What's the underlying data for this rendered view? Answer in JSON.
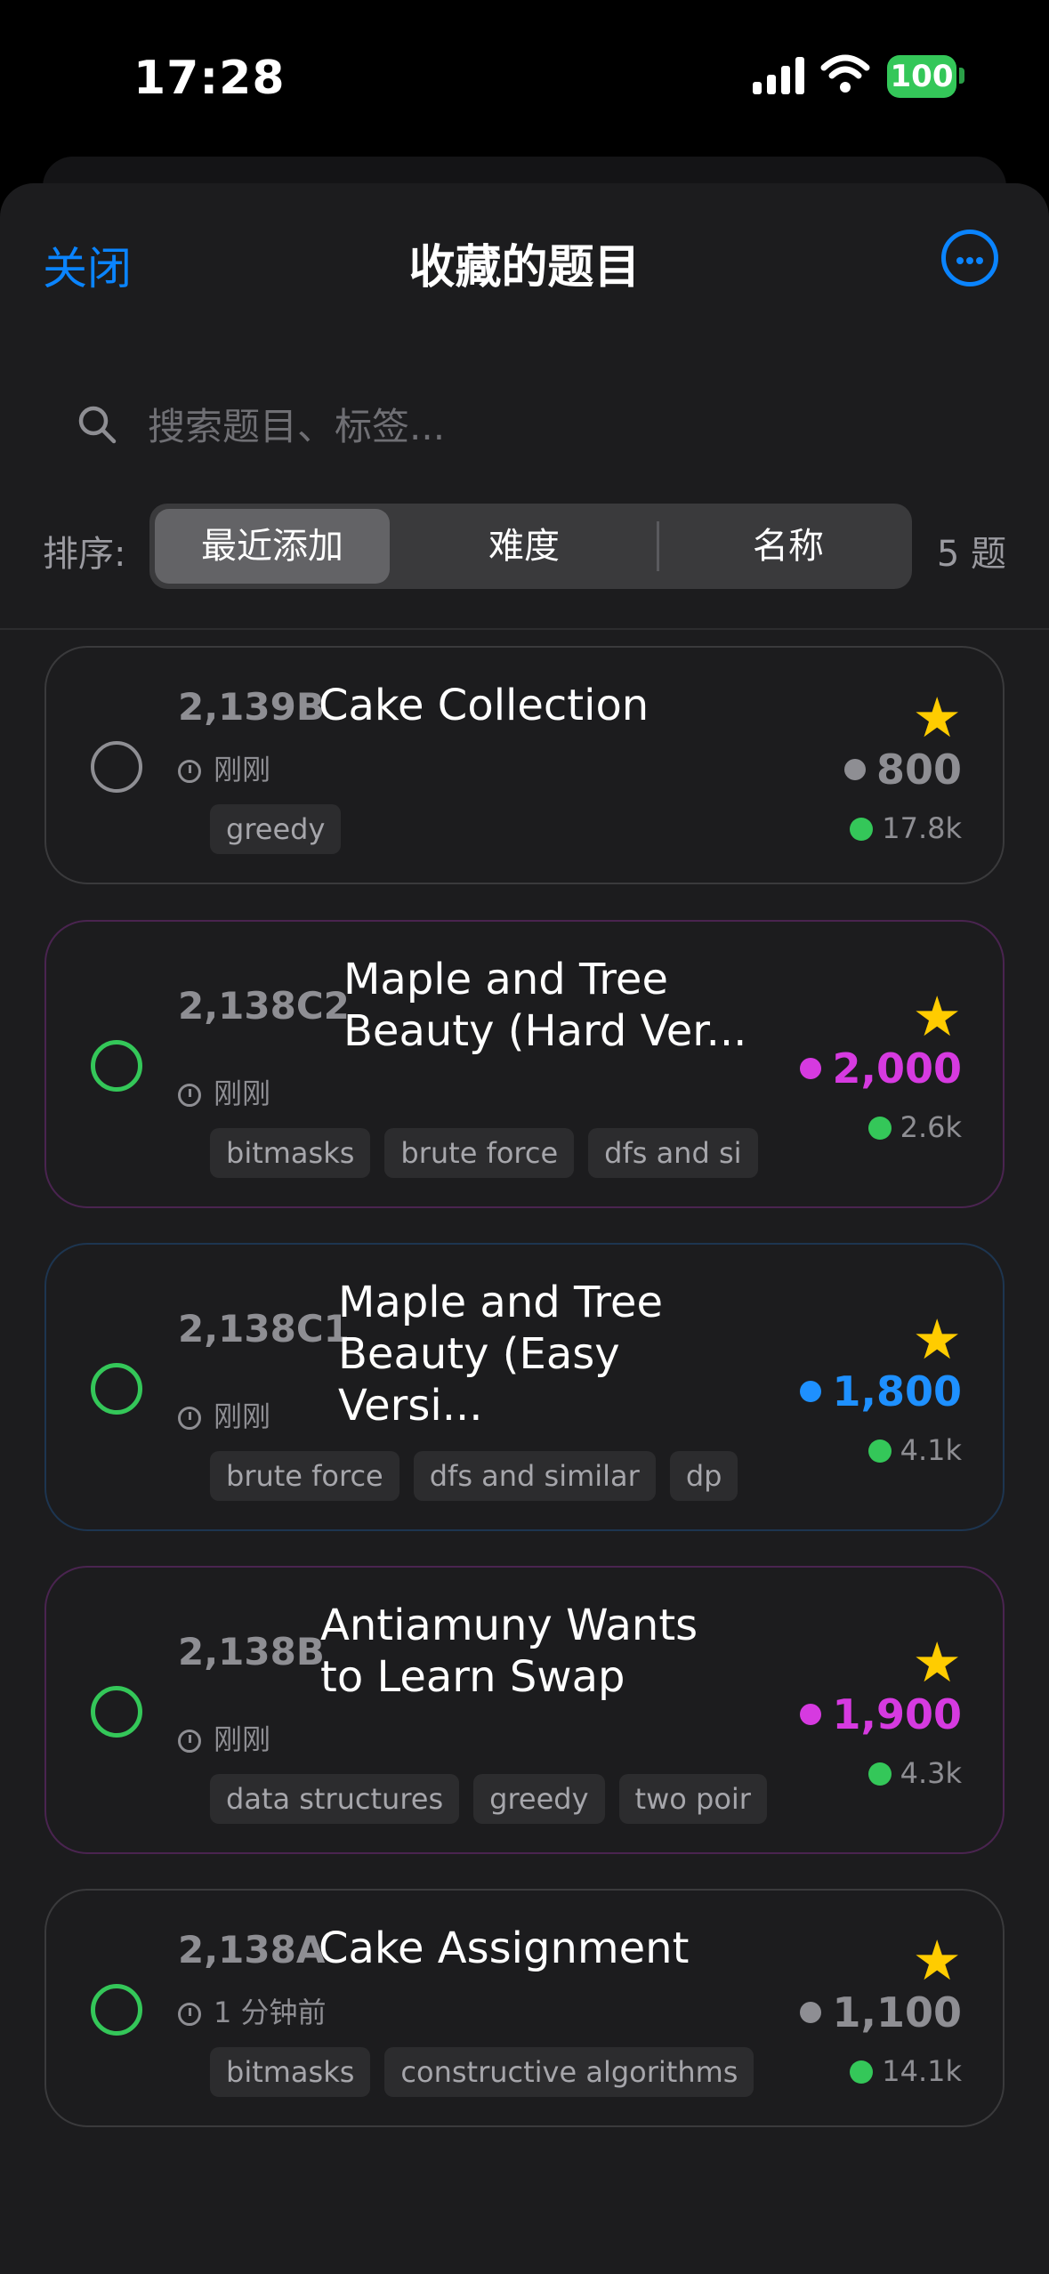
{
  "status_bar": {
    "time": "17:28",
    "battery": "100"
  },
  "nav": {
    "close": "关闭",
    "title": "收藏的题目"
  },
  "search": {
    "placeholder": "搜索题目、标签..."
  },
  "sort": {
    "label": "排序:",
    "options": [
      "最近添加",
      "难度",
      "名称"
    ],
    "selected": "最近添加",
    "count": "5 题"
  },
  "colors": {
    "accent": "#0a84ff",
    "success": "#34c759",
    "star": "#ffcc00",
    "gray_rating": "#8e8e93",
    "purple_rating": "#d63ae0",
    "blue_rating": "#1e90ff"
  },
  "problems": [
    {
      "id": "2,139B",
      "title": "Cake Collection",
      "time": "刚刚",
      "tags": [
        "greedy"
      ],
      "rating": "800",
      "solved": "17.8k",
      "done": false
    },
    {
      "id": "2,138C2",
      "title": "Maple and Tree Beauty (Hard Ver...",
      "time": "刚刚",
      "tags": [
        "bitmasks",
        "brute force",
        "dfs and si"
      ],
      "rating": "2,000",
      "solved": "2.6k",
      "done": true
    },
    {
      "id": "2,138C1",
      "title": "Maple and Tree Beauty (Easy Versi...",
      "time": "刚刚",
      "tags": [
        "brute force",
        "dfs and similar",
        "dp"
      ],
      "rating": "1,800",
      "solved": "4.1k",
      "done": true
    },
    {
      "id": "2,138B",
      "title": "Antiamuny Wants to Learn Swap",
      "time": "刚刚",
      "tags": [
        "data structures",
        "greedy",
        "two poir"
      ],
      "rating": "1,900",
      "solved": "4.3k",
      "done": true
    },
    {
      "id": "2,138A",
      "title": "Cake Assignment",
      "time": "1 分钟前",
      "tags": [
        "bitmasks",
        "constructive algorithms"
      ],
      "rating": "1,100",
      "solved": "14.1k",
      "done": true
    }
  ]
}
